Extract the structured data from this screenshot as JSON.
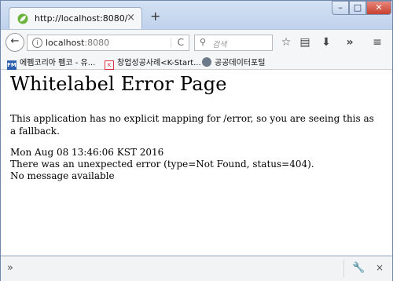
{
  "window": {
    "minimize_glyph": "–",
    "maximize_glyph": "□",
    "close_glyph": "✕"
  },
  "tab": {
    "title": "http://localhost:8080/",
    "icon": "spring-leaf-icon",
    "close_glyph": "×"
  },
  "newtab_glyph": "+",
  "navbar": {
    "back_glyph": "←",
    "url_host": "localhost",
    "url_port": ":8080",
    "reload_glyph": "C",
    "search_placeholder": "검색",
    "icons": [
      "bookmark-star-icon",
      "reading-list-icon",
      "download-icon",
      "overflow-icon",
      "menu-icon"
    ]
  },
  "bookmarks": [
    {
      "label": "에펨코리아 펨코 - 유...",
      "icon_text": "FM"
    },
    {
      "label": "창업성공사례<K-Start...",
      "icon_text": "K"
    },
    {
      "label": "공공데이터포털",
      "icon_text": ""
    }
  ],
  "page": {
    "heading": "Whitelabel Error Page",
    "message": "This application has no explicit mapping for /error, so you are seeing this as a fallback.",
    "timestamp": "Mon Aug 08 13:46:06 KST 2016",
    "error": "There was an unexpected error (type=Not Found, status=404).",
    "detail": "No message available"
  },
  "statusbar": {
    "left_glyph": "»",
    "close_glyph": "×"
  }
}
